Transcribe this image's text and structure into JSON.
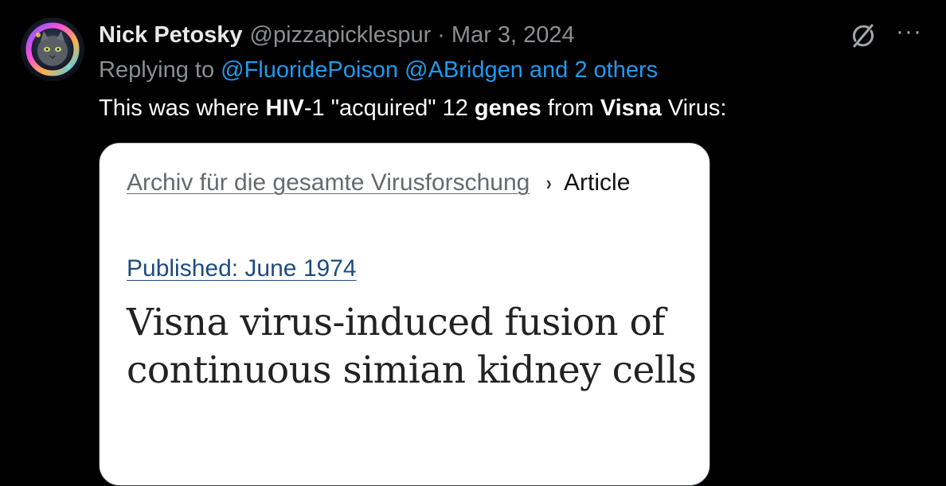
{
  "tweet": {
    "author": {
      "display_name": "Nick Petosky",
      "handle": "@pizzapicklespur",
      "avatar_icon": "astronaut-cat-avatar"
    },
    "separator": "·",
    "date": "Mar 3, 2024",
    "reply": {
      "prefix": "Replying to",
      "mentions": "@FluoridePoison @ABridgen and 2 others"
    },
    "text": {
      "part1": "This was where ",
      "bold1": "HIV",
      "part2": "-1 \"acquired\" 12 ",
      "bold2": "genes",
      "part3": " from ",
      "bold3": "Visna",
      "part4": " Virus:"
    },
    "actions": {
      "grok_icon": "grok-icon",
      "more_label": "···"
    }
  },
  "card": {
    "breadcrumb": {
      "journal": "Archiv für die gesamte Virusforschung",
      "separator": "›",
      "current": "Article"
    },
    "published": "Published: June 1974",
    "title": "Visna virus-induced fusion of continuous simian kidney cells"
  },
  "colors": {
    "background": "#000000",
    "text_primary": "#e7e9ea",
    "text_secondary": "#8b8f94",
    "link_blue": "#1d9bf0",
    "published_link": "#1e4b80",
    "card_bg": "#ffffff"
  }
}
